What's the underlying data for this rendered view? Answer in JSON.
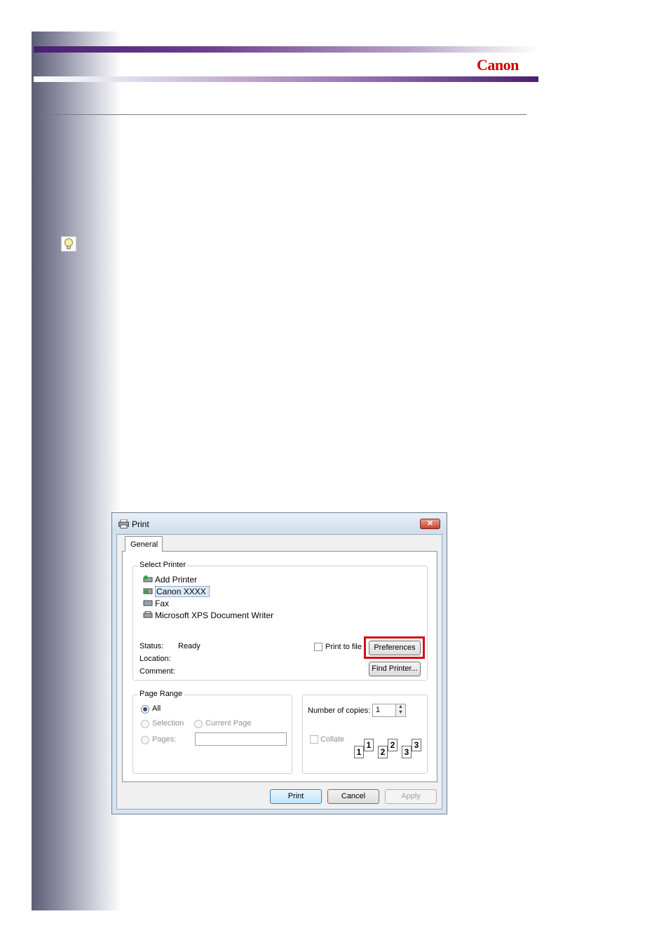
{
  "brand": {
    "logo_text": "Canon"
  },
  "dialog": {
    "title": "Print",
    "tab": "General",
    "select_printer": {
      "label": "Select Printer",
      "printers": [
        "Add Printer",
        "Canon XXXX",
        "Fax",
        "Microsoft XPS Document Writer"
      ],
      "selected": "Canon XXXX",
      "status_label": "Status:",
      "status_value": "Ready",
      "location_label": "Location:",
      "comment_label": "Comment:",
      "print_to_file": "Print to file",
      "preferences": "Preferences",
      "find_printer": "Find Printer..."
    },
    "page_range": {
      "label": "Page Range",
      "all": "All",
      "selection": "Selection",
      "current_page": "Current Page",
      "pages": "Pages:"
    },
    "copies": {
      "label": "Number of copies:",
      "value": "1",
      "collate": "Collate",
      "page_numbers": [
        "1",
        "1",
        "2",
        "2",
        "3",
        "3"
      ]
    },
    "buttons": {
      "print": "Print",
      "cancel": "Cancel",
      "apply": "Apply"
    }
  },
  "colors": {
    "highlight": "#d01010",
    "band": "#4b1f72",
    "logo": "#cc0000"
  },
  "icons": [
    "tip-lightbulb-icon",
    "printer-icon",
    "close-icon"
  ]
}
